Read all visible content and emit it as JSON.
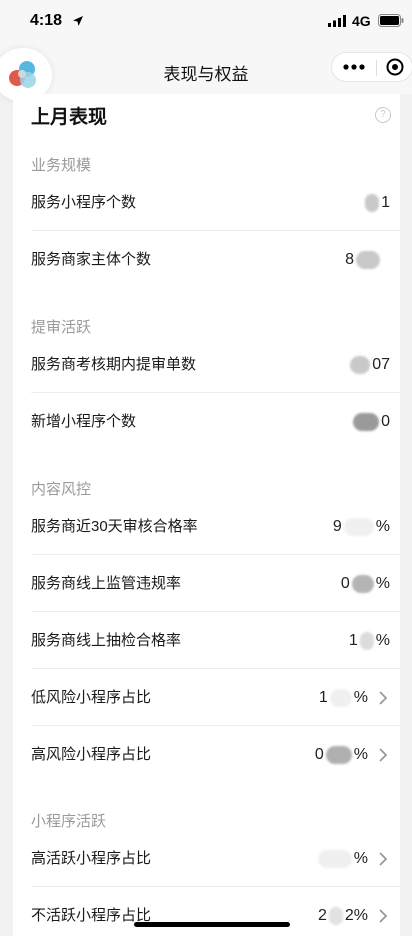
{
  "status_bar": {
    "time": "4:18",
    "network": "4G"
  },
  "nav": {
    "title": "表现与权益"
  },
  "card": {
    "title": "上月表现",
    "help_symbol": "?",
    "sections": {
      "scale": "业务规模",
      "activity": "提审活跃",
      "risk": "内容风控",
      "miniapp_activity": "小程序活跃"
    },
    "rows": {
      "miniapp_count": {
        "label": "服务小程序个数",
        "value_visible": "1"
      },
      "entity_count": {
        "label": "服务商家主体个数",
        "value_visible": "8"
      },
      "submit_count": {
        "label": "服务商考核期内提审单数",
        "value_visible": "07"
      },
      "new_miniapp": {
        "label": "新增小程序个数",
        "value_visible": "0"
      },
      "audit_pass_rate": {
        "label": "服务商近30天审核合格率",
        "value_visible": "9",
        "value_suffix": "%"
      },
      "violation_rate": {
        "label": "服务商线上监管违规率",
        "value_visible": "0",
        "value_suffix": "%"
      },
      "spot_check_rate": {
        "label": "服务商线上抽检合格率",
        "value_visible": "1",
        "value_suffix": "%"
      },
      "low_risk": {
        "label": "低风险小程序占比",
        "value_visible": "1",
        "value_suffix": "%"
      },
      "high_risk": {
        "label": "高风险小程序占比",
        "value_visible": "0",
        "value_suffix": "%"
      },
      "high_active": {
        "label": "高活跃小程序占比",
        "value_suffix": "%"
      },
      "inactive": {
        "label": "不活跃小程序占比",
        "value_visible": "2",
        "value_suffix": "2%"
      }
    }
  },
  "colors": {
    "section_gray": "#9a9a9a",
    "background": "#f2f2f2",
    "card": "#ffffff"
  }
}
